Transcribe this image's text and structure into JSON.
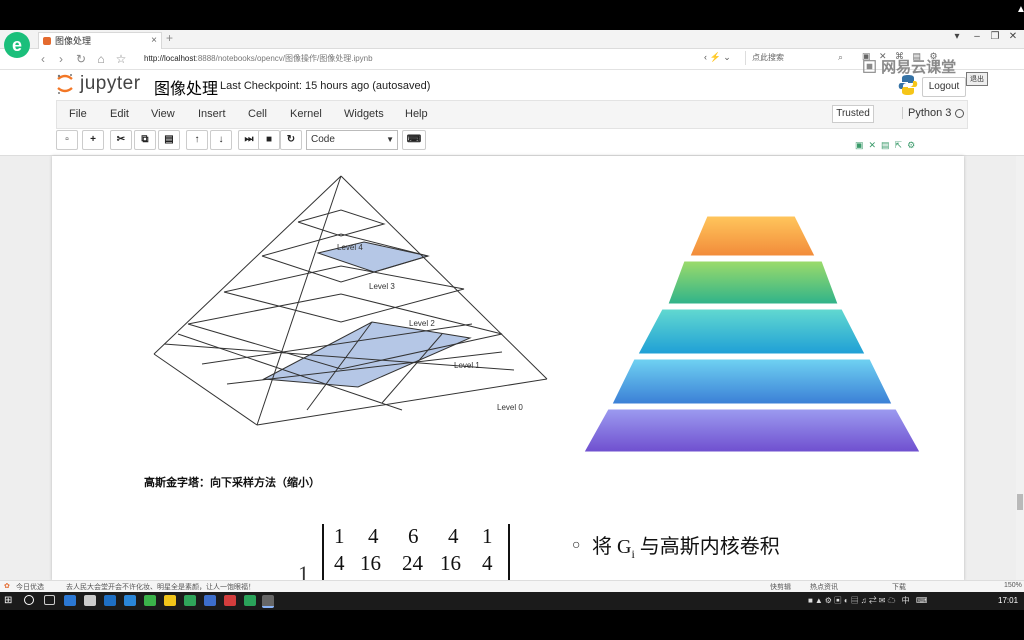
{
  "browser": {
    "tab_title": "图像处理",
    "url_host": "http://localhost",
    "url_rest": ":8888/notebooks/opencv/图像操作/图像处理.ipynb",
    "search_placeholder": "点此搜索"
  },
  "watermark": {
    "brand": "网易云课堂",
    "exit_label": "退出"
  },
  "jupyter": {
    "app_name": "jupyter",
    "notebook_title": "图像处理",
    "checkpoint": "Last Checkpoint: 15 hours ago (autosaved)",
    "logout_label": "Logout",
    "menu": [
      "File",
      "Edit",
      "View",
      "Insert",
      "Cell",
      "Kernel",
      "Widgets",
      "Help"
    ],
    "trusted_label": "Trusted",
    "kernel_name": "Python 3",
    "cell_type": "Code"
  },
  "figure": {
    "levels": [
      "Level 4",
      "Level 3",
      "Level 2",
      "Level 1",
      "Level 0"
    ]
  },
  "caption": "高斯金字塔：向下采样方法（缩小）",
  "matrix": {
    "scale": "1",
    "rows": [
      [
        "1",
        "4",
        "6",
        "4",
        "1"
      ],
      [
        "4",
        "16",
        "24",
        "16",
        "4"
      ]
    ]
  },
  "bullet": {
    "prefix": "将 ",
    "symbol": "G",
    "sub": "i",
    "suffix": " 与高斯内核卷积"
  },
  "statusbar": {
    "left_label": "今日优选",
    "news": "去人民大会堂开会不许化妆、明星全是素颜，让人一饱眼福！",
    "right_items": [
      "快剪辑",
      "热点资讯",
      "下载",
      "150%"
    ]
  },
  "taskbar": {
    "time": "17:01"
  },
  "colors": {
    "level3_fill": "#b5c7e6",
    "level1_fill": "#b5c7e6",
    "jupyter_orange": "#f37726"
  }
}
